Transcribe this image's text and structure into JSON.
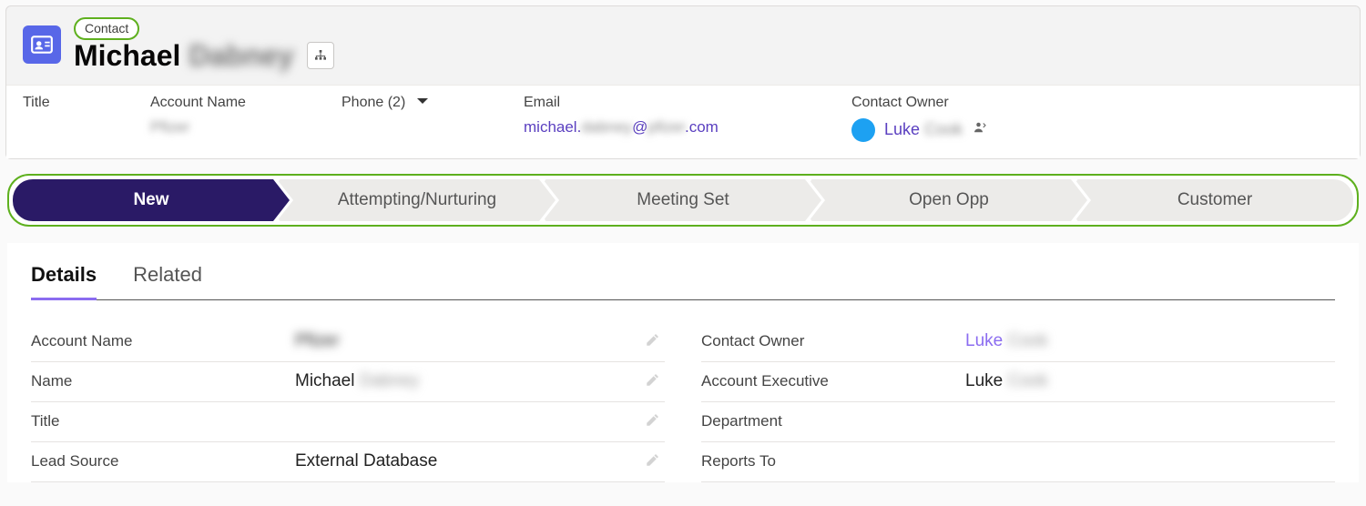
{
  "object_label": "Contact",
  "record": {
    "first_name": "Michael",
    "last_name": "Dabney"
  },
  "summary": {
    "title_label": "Title",
    "title_value": "",
    "account_label": "Account Name",
    "account_value": "Pfizer",
    "phone_label": "Phone (2)",
    "email_label": "Email",
    "email_prefix": "michael.",
    "email_mid": "dabney",
    "email_suffix": "@",
    "email_domain_blur": "pfizer",
    "email_tld": ".com",
    "owner_label": "Contact Owner",
    "owner_first": "Luke",
    "owner_last": "Cook"
  },
  "path": {
    "steps": [
      "New",
      "Attempting/Nurturing",
      "Meeting Set",
      "Open Opp",
      "Customer"
    ],
    "current_index": 0
  },
  "tabs": {
    "details": "Details",
    "related": "Related",
    "active": "details"
  },
  "details": {
    "left": [
      {
        "label": "Account Name",
        "value": "Pfizer",
        "blur": true,
        "editable": true
      },
      {
        "label": "Name",
        "value_first": "Michael",
        "value_last": "Dabney",
        "editable": true
      },
      {
        "label": "Title",
        "value": "",
        "editable": true
      },
      {
        "label": "Lead Source",
        "value": "External Database",
        "editable": true
      }
    ],
    "right": [
      {
        "label": "Contact Owner",
        "value_first": "Luke",
        "value_last": "Cook",
        "link": true
      },
      {
        "label": "Account Executive",
        "value_first": "Luke",
        "value_last": "Cook"
      },
      {
        "label": "Department",
        "value": ""
      },
      {
        "label": "Reports To",
        "value": ""
      }
    ]
  }
}
